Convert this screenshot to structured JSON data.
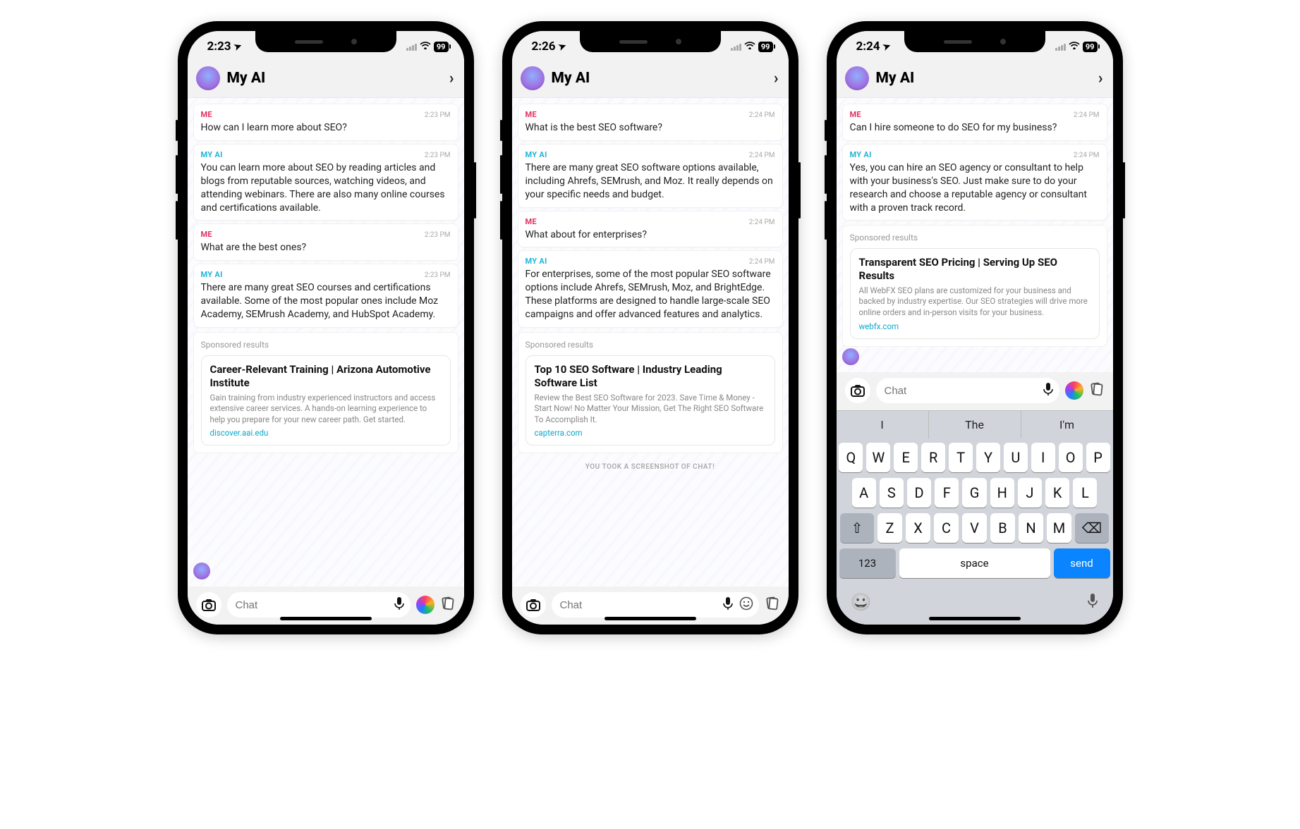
{
  "phones": [
    {
      "status_time": "2:23",
      "battery": "99",
      "chat_title": "My AI",
      "messages": [
        {
          "sender": "ME",
          "css": "sender-me",
          "time": "2:23 PM",
          "body": "How can I learn more about SEO?"
        },
        {
          "sender": "MY AI",
          "css": "sender-ai",
          "time": "2:23 PM",
          "body": "You can learn more about SEO by reading articles and blogs from reputable sources, watching videos, and attending webinars. There are also many online courses and certifications available."
        },
        {
          "sender": "ME",
          "css": "sender-me",
          "time": "2:23 PM",
          "body": "What are the best ones?"
        },
        {
          "sender": "MY AI",
          "css": "sender-ai",
          "time": "2:23 PM",
          "body": "There are many great SEO courses and certifications available. Some of the most popular ones include Moz Academy, SEMrush Academy, and HubSpot Academy."
        }
      ],
      "sponsored": {
        "label": "Sponsored results",
        "title": "Career-Relevant Training | Arizona Automotive Institute",
        "desc": "Gain training from industry experienced instructors and access extensive career services. A hands-on learning experience to help you prepare for your new career path. Get started.",
        "link": "discover.aai.edu"
      },
      "show_avatar_bottom": true,
      "screenshot_banner": "",
      "input_placeholder": "Chat",
      "show_keyboard": false,
      "show_emoji_icon": false,
      "show_rocket": true
    },
    {
      "status_time": "2:26",
      "battery": "99",
      "chat_title": "My AI",
      "messages": [
        {
          "sender": "ME",
          "css": "sender-me",
          "time": "2:24 PM",
          "body": "What is the best SEO software?"
        },
        {
          "sender": "MY AI",
          "css": "sender-ai",
          "time": "2:24 PM",
          "body": "There are many great SEO software options available, including Ahrefs, SEMrush, and Moz. It really depends on your specific needs and budget."
        },
        {
          "sender": "ME",
          "css": "sender-me",
          "time": "2:24 PM",
          "body": "What about for enterprises?"
        },
        {
          "sender": "MY AI",
          "css": "sender-ai",
          "time": "2:24 PM",
          "body": "For enterprises, some of the most popular SEO software options include Ahrefs, SEMrush, Moz, and BrightEdge. These platforms are designed to handle large-scale SEO campaigns and offer advanced features and analytics."
        }
      ],
      "sponsored": {
        "label": "Sponsored results",
        "title": "Top 10 SEO Software | Industry Leading Software List",
        "desc": "Review the Best SEO Software for 2023. Save Time & Money - Start Now! No Matter Your Mission, Get The Right SEO Software To Accomplish It.",
        "link": "capterra.com"
      },
      "show_avatar_bottom": false,
      "screenshot_banner": "YOU TOOK A SCREENSHOT OF CHAT!",
      "input_placeholder": "Chat",
      "show_keyboard": false,
      "show_emoji_icon": true,
      "show_rocket": false
    },
    {
      "status_time": "2:24",
      "battery": "99",
      "chat_title": "My AI",
      "messages": [
        {
          "sender": "ME",
          "css": "sender-me",
          "time": "2:24 PM",
          "body": "Can I hire someone to do SEO for my business?"
        },
        {
          "sender": "MY AI",
          "css": "sender-ai",
          "time": "2:24 PM",
          "body": "Yes, you can hire an SEO agency or consultant to help with your business's SEO. Just make sure to do your research and choose a reputable agency or consultant with a proven track record."
        }
      ],
      "sponsored": {
        "label": "Sponsored results",
        "title": "Transparent SEO Pricing | Serving Up SEO Results",
        "desc": "All WebFX SEO plans are customized for your business and backed by industry expertise. Our SEO strategies will drive more online orders and in-person visits for your business.",
        "link": "webfx.com"
      },
      "show_avatar_bottom": true,
      "screenshot_banner": "",
      "input_placeholder": "Chat",
      "show_keyboard": true,
      "show_emoji_icon": false,
      "show_rocket": true,
      "keyboard": {
        "suggestions": [
          "I",
          "The",
          "I'm"
        ],
        "rows": [
          [
            "Q",
            "W",
            "E",
            "R",
            "T",
            "Y",
            "U",
            "I",
            "O",
            "P"
          ],
          [
            "A",
            "S",
            "D",
            "F",
            "G",
            "H",
            "J",
            "K",
            "L"
          ],
          [
            "⇧",
            "Z",
            "X",
            "C",
            "V",
            "B",
            "N",
            "M",
            "⌫"
          ]
        ],
        "bottom": {
          "num": "123",
          "space": "space",
          "send": "send"
        }
      }
    }
  ]
}
